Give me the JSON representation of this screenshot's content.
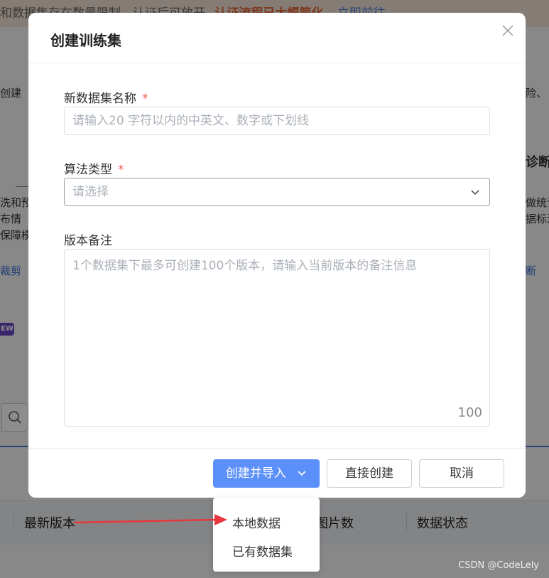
{
  "background": {
    "banner_text": "和数据集存在数量限制，认证后可放开",
    "banner_warn": "认证流程已大幅简化",
    "banner_link": "立即前往",
    "left_snippets": [
      "创建",
      "洗和预",
      "布情",
      "保障模",
      "裁剪"
    ],
    "right_snippets": [
      "险、",
      "诊断",
      "做统计",
      "据标注",
      "断"
    ],
    "new_badge": "EW",
    "table_columns": [
      "最新版本",
      "图片数",
      "数据状态"
    ]
  },
  "modal": {
    "title": "创建训练集",
    "fields": {
      "name": {
        "label": "新数据集名称",
        "required_mark": "*",
        "placeholder": "请输入20 字符以内的中英文、数字或下划线"
      },
      "algorithm": {
        "label": "算法类型",
        "required_mark": "*",
        "placeholder": "请选择"
      },
      "note": {
        "label": "版本备注",
        "placeholder": "1个数据集下最多可创建100个版本，请输入当前版本的备注信息",
        "counter": "100"
      }
    },
    "buttons": {
      "create_import": "创建并导入",
      "direct_create": "直接创建",
      "cancel": "取消"
    }
  },
  "dropdown": {
    "items": [
      "本地数据",
      "已有数据集"
    ]
  },
  "watermark": "CSDN @CodeLely",
  "colors": {
    "primary": "#5b8ff9",
    "required": "#f25a4a",
    "annotation_arrow": "#e8383d"
  }
}
